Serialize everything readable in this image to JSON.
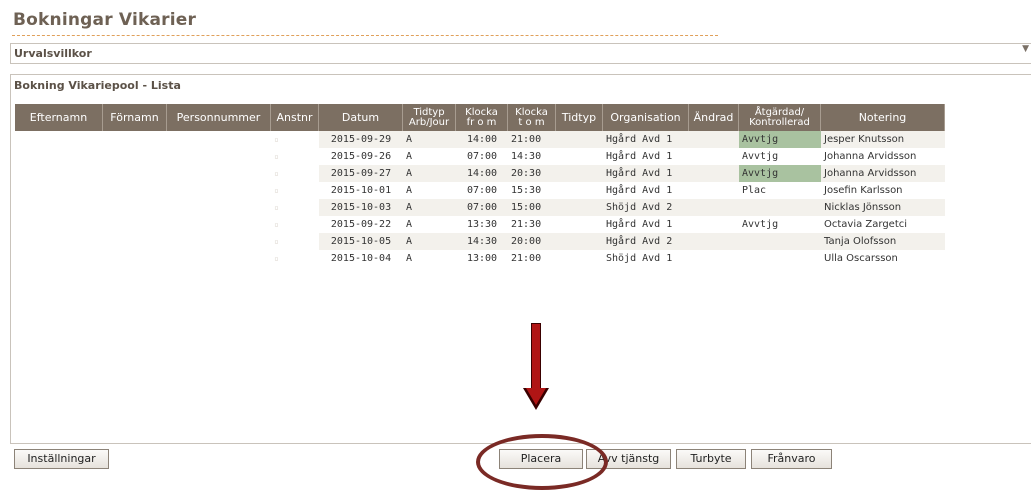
{
  "page": {
    "title": "Bokningar Vikarier"
  },
  "urval": {
    "label": "Urvalsvillkor",
    "caret": "▼"
  },
  "list": {
    "title": "Bokning Vikariepool - Lista",
    "headers": [
      {
        "line1": "Efternamn",
        "line2": ""
      },
      {
        "line1": "Förnamn",
        "line2": ""
      },
      {
        "line1": "Personnummer",
        "line2": ""
      },
      {
        "line1": "Anstnr",
        "line2": ""
      },
      {
        "line1": "Datum",
        "line2": ""
      },
      {
        "line1": "Tidtyp",
        "line2": "Arb/Jour"
      },
      {
        "line1": "Klocka",
        "line2": "fr o m"
      },
      {
        "line1": "Klocka",
        "line2": "t o m"
      },
      {
        "line1": "Tidtyp",
        "line2": ""
      },
      {
        "line1": "Organisation",
        "line2": ""
      },
      {
        "line1": "Ändrad",
        "line2": ""
      },
      {
        "line1": "Åtgärdad/",
        "line2": "Kontrollerad"
      },
      {
        "line1": "Notering",
        "line2": ""
      }
    ],
    "rows": [
      {
        "tick": "▫",
        "datum": "2015-09-29",
        "tidtyp": "A",
        "from": "14:00",
        "tom": "21:00",
        "tidtyp2": "",
        "org": "Hgård Avd 1",
        "andrad": "",
        "atgard": "Avvtjg",
        "atgard_hl": true,
        "notering": "Jesper Knutsson"
      },
      {
        "tick": "▫",
        "datum": "2015-09-26",
        "tidtyp": "A",
        "from": "07:00",
        "tom": "14:30",
        "tidtyp2": "",
        "org": "Hgård Avd 1",
        "andrad": "",
        "atgard": "Avvtjg",
        "atgard_hl": false,
        "notering": "Johanna Arvidsson"
      },
      {
        "tick": "▫",
        "datum": "2015-09-27",
        "tidtyp": "A",
        "from": "14:00",
        "tom": "20:30",
        "tidtyp2": "",
        "org": "Hgård Avd 1",
        "andrad": "",
        "atgard": "Avvtjg",
        "atgard_hl": true,
        "notering": "Johanna Arvidsson"
      },
      {
        "tick": "▫",
        "datum": "2015-10-01",
        "tidtyp": "A",
        "from": "07:00",
        "tom": "15:30",
        "tidtyp2": "",
        "org": "Hgård Avd 1",
        "andrad": "",
        "atgard": "Plac",
        "atgard_hl": false,
        "notering": "Josefin Karlsson"
      },
      {
        "tick": "▫",
        "datum": "2015-10-03",
        "tidtyp": "A",
        "from": "07:00",
        "tom": "15:00",
        "tidtyp2": "",
        "org": "Shöjd Avd 2",
        "andrad": "",
        "atgard": "",
        "atgard_hl": false,
        "notering": "Nicklas Jönsson"
      },
      {
        "tick": "▫",
        "datum": "2015-09-22",
        "tidtyp": "A",
        "from": "13:30",
        "tom": "21:30",
        "tidtyp2": "",
        "org": "Hgård Avd 1",
        "andrad": "",
        "atgard": "Avvtjg",
        "atgard_hl": false,
        "notering": "Octavia Zargetci"
      },
      {
        "tick": "▫",
        "datum": "2015-10-05",
        "tidtyp": "A",
        "from": "14:30",
        "tom": "20:00",
        "tidtyp2": "",
        "org": "Hgård Avd 2",
        "andrad": "",
        "atgard": "",
        "atgard_hl": false,
        "notering": "Tanja Olofsson"
      },
      {
        "tick": "▫",
        "datum": "2015-10-04",
        "tidtyp": "A",
        "from": "13:00",
        "tom": "21:00",
        "tidtyp2": "",
        "org": "Shöjd Avd 1",
        "andrad": "",
        "atgard": "",
        "atgard_hl": false,
        "notering": "Ulla Oscarsson"
      }
    ]
  },
  "buttons": {
    "installningar": "Inställningar",
    "placera": "Placera",
    "avv_tjanstg": "Avv tjänstg",
    "turbyte": "Turbyte",
    "franvaro": "Frånvaro"
  },
  "annotation": {
    "arrow_color": "#b01515",
    "circle_color": "#7a2a25"
  }
}
